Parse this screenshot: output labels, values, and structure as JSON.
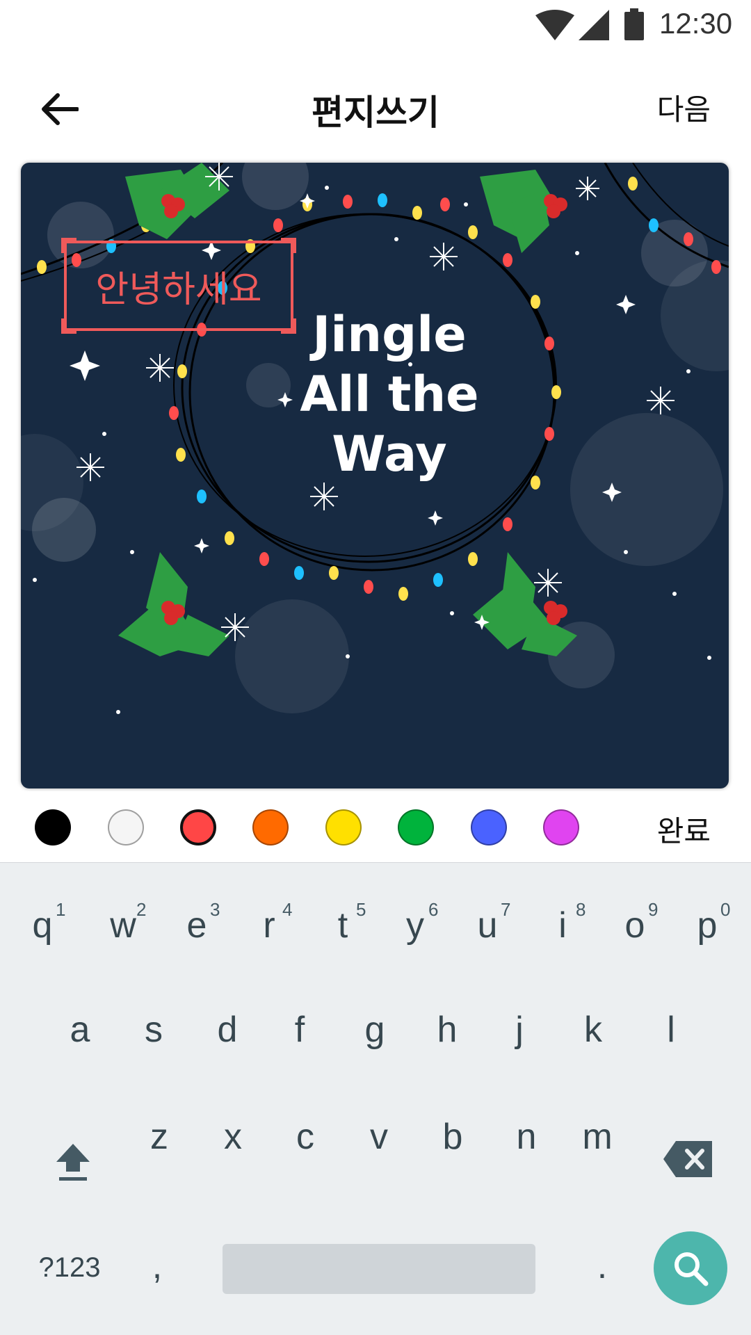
{
  "status_bar": {
    "time": "12:30"
  },
  "app_bar": {
    "title": "편지쓰기",
    "next_label": "다음"
  },
  "card": {
    "greeting": "안녕하세요",
    "title_lines": [
      "Jingle",
      "All the",
      "Way"
    ]
  },
  "palette": {
    "colors": [
      "#000000",
      "#f5f5f5",
      "#ff4646",
      "#ff6a00",
      "#ffe000",
      "#00b33c",
      "#4a62ff",
      "#e044f0"
    ],
    "selected_index": 2,
    "done_label": "완료"
  },
  "keyboard": {
    "row1": [
      "q",
      "w",
      "e",
      "r",
      "t",
      "y",
      "u",
      "i",
      "o",
      "p"
    ],
    "row1_hints": [
      "1",
      "2",
      "3",
      "4",
      "5",
      "6",
      "7",
      "8",
      "9",
      "0"
    ],
    "row2": [
      "a",
      "s",
      "d",
      "f",
      "g",
      "h",
      "j",
      "k",
      "l"
    ],
    "row3": [
      "z",
      "x",
      "c",
      "v",
      "b",
      "n",
      "m"
    ],
    "symbols_label": "?123",
    "comma_label": ",",
    "period_label": ".",
    "accent": "#4db6ac"
  }
}
